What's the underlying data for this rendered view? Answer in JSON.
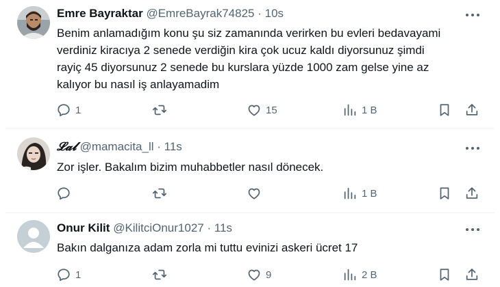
{
  "posts": [
    {
      "name": "Emre Bayraktar",
      "handle": "@EmreBayrak74825",
      "separator": "·",
      "time": "10s",
      "text": "Benim anlamadığım konu şu siz zamanında verirken bu evleri bedavayami\nverdiniz kiracıya 2 senede  verdiğin kira çok ucuz kaldı diyorsunuz şimdi\nrayiç 45 diyorsunuz 2 senede bu kurslara yüzde 1000 zam gelse yine az\nkalıyor bu nasıl iş anlayamadim",
      "replies": "1",
      "reposts": "",
      "likes": "15",
      "views": "1 B",
      "avatar": "man-with-beard-photo"
    },
    {
      "name": "𝓛𝓪𝓵",
      "handle": "@mamacita_ll",
      "separator": "·",
      "time": "11s",
      "text": "Zor işler. Bakalım bizim muhabbetler nasıl dönecek.",
      "replies": "",
      "reposts": "",
      "likes": "",
      "views": "1 B",
      "avatar": "woman-with-filter-photo"
    },
    {
      "name": "Onur Kilit",
      "handle": "@KilitciOnur1027",
      "separator": "·",
      "time": "11s",
      "text": "Bakın dalganıza adam zorla mi tuttu evinizi askeri ücret 17",
      "replies": "1",
      "reposts": "",
      "likes": "9",
      "views": "2 B",
      "avatar": "default-person-silhouette"
    }
  ],
  "colors": {
    "text": "#0f1419",
    "secondary": "#536471",
    "divider": "#eff3f4",
    "default_avatar_bg": "#c4cfd6"
  },
  "icons": [
    "reply-icon",
    "repost-icon",
    "like-icon",
    "views-icon",
    "bookmark-icon",
    "share-icon",
    "more-icon"
  ]
}
